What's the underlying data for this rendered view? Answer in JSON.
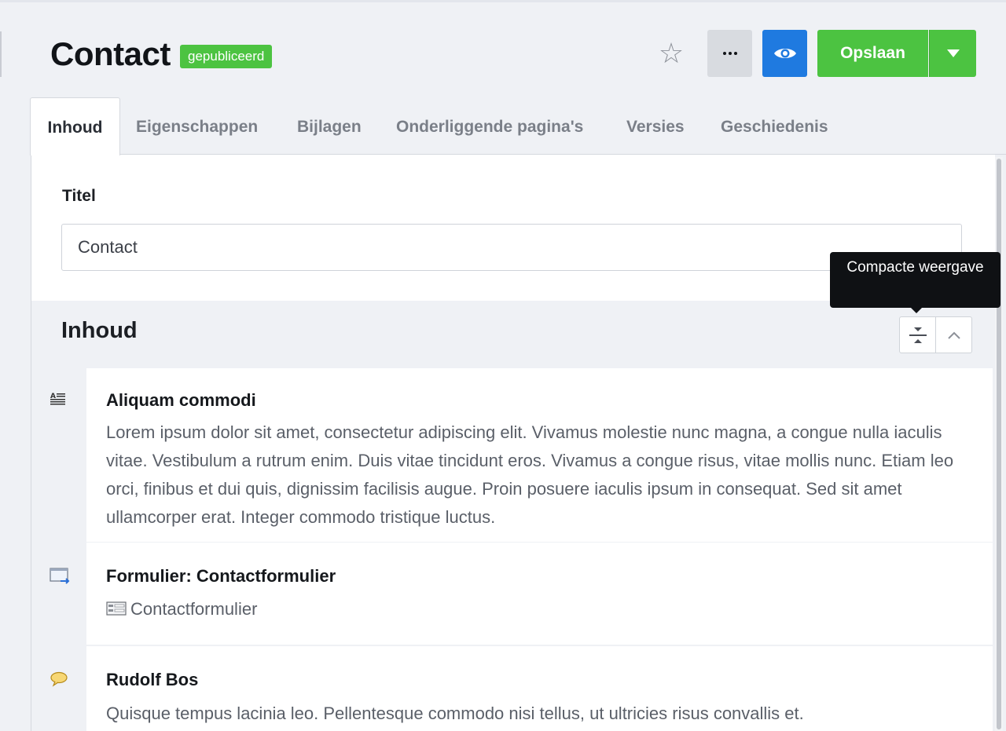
{
  "header": {
    "title": "Contact",
    "status": "gepubliceerd",
    "save_label": "Opslaan"
  },
  "tabs": [
    {
      "label": "Inhoud",
      "active": true
    },
    {
      "label": "Eigenschappen"
    },
    {
      "label": "Bijlagen"
    },
    {
      "label": "Onderliggende pagina's"
    },
    {
      "label": "Versies"
    },
    {
      "label": "Geschiedenis"
    }
  ],
  "form": {
    "title_label": "Titel",
    "title_value": "Contact"
  },
  "content": {
    "heading": "Inhoud",
    "tooltip": "Compacte weergave",
    "blocks": [
      {
        "icon": "text-block-icon",
        "title": "Aliquam commodi",
        "text": "Lorem ipsum dolor sit amet, consectetur adipiscing elit. Vivamus molestie nunc magna, a congue nulla iaculis vitae. Vestibulum a rutrum enim. Duis vitae tincidunt eros. Vivamus a congue risus, vitae mollis nunc. Etiam leo orci, finibus et dui quis, dignissim facilisis augue. Proin posuere iaculis ipsum in consequat. Sed sit amet ullamcorper erat. Integer commodo tristique luctus."
      },
      {
        "icon": "form-block-icon",
        "title": "Formulier: Contactformulier",
        "text": "Contactformulier"
      },
      {
        "icon": "quote-block-icon",
        "title": "Rudolf Bos",
        "text": "Quisque tempus lacinia leo. Pellentesque commodo nisi tellus, ut ultricies risus convallis et."
      }
    ]
  },
  "colors": {
    "primary_green": "#4cc341",
    "preview_blue": "#1f7ae0"
  }
}
